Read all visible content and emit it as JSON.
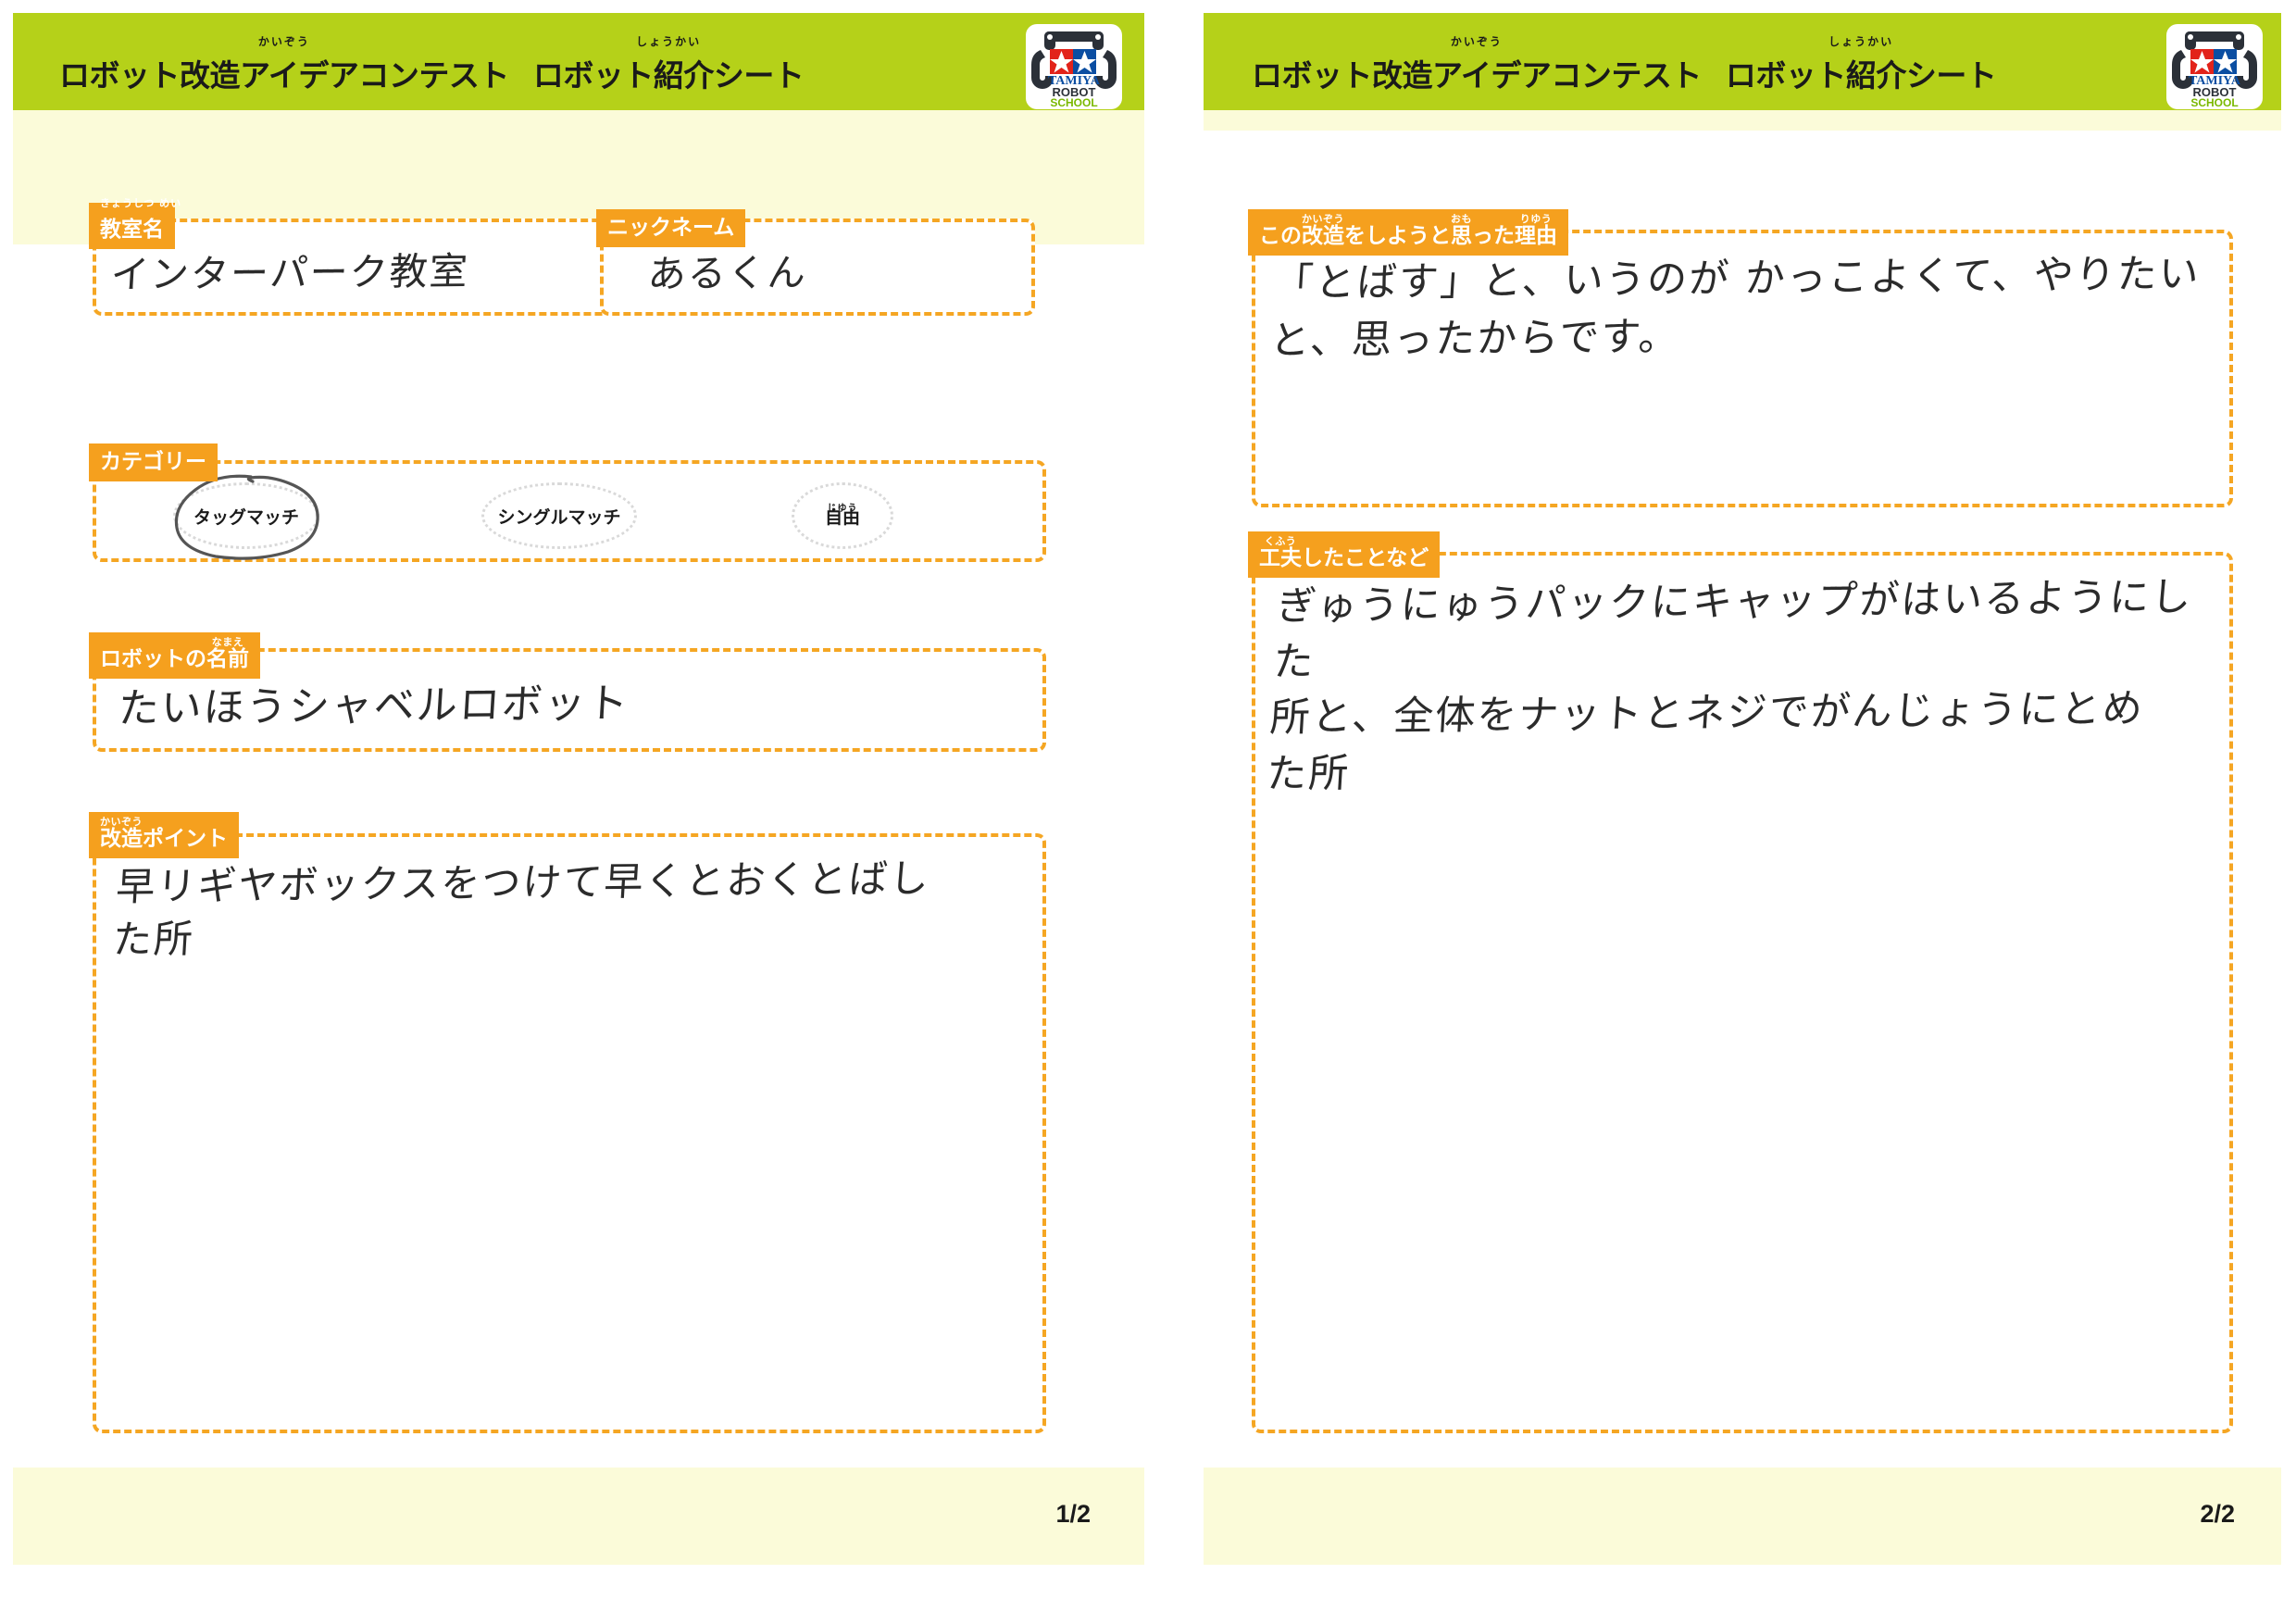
{
  "document": {
    "title": "ロボット改造アイデアコンテスト　ロボット紹介シート",
    "title_part1": "ロボット改造アイデアコンテスト",
    "title_part2": "ロボット紹介シート",
    "ruby_kaizou": "かいぞう",
    "ruby_shoukai": "しょうかい"
  },
  "logo": {
    "brand": "TAMIYA",
    "line2": "ROBOT",
    "line3": "SCHOOL",
    "alt": "tamiya-robot-school-logo"
  },
  "colors": {
    "header_green": "#b5d119",
    "label_orange": "#f5a01e",
    "dash_orange": "#f5a623",
    "cream": "#fbfbd9",
    "ink": "#2b2b2b",
    "logo_red": "#e2231a",
    "logo_blue": "#0b4ea2"
  },
  "page_left": {
    "page_number": "1/2",
    "classroom": {
      "label": "教室名",
      "ruby": "きょうしつ めい",
      "value": "インターパーク教室"
    },
    "nickname": {
      "label": "ニックネーム",
      "ruby": "",
      "value": "あるくん"
    },
    "category": {
      "label": "カテゴリー",
      "ruby": "",
      "options": [
        {
          "label": "タッグマッチ",
          "ruby": "",
          "selected": true
        },
        {
          "label": "シングルマッチ",
          "ruby": "",
          "selected": false
        },
        {
          "label": "自由",
          "ruby": "じゆう",
          "selected": false
        }
      ],
      "selected_value": "タッグマッチ"
    },
    "robot_name": {
      "label_a": "ロボットの",
      "label_b": "名前",
      "ruby": "なまえ",
      "value": "たいほうシャベルロボット"
    },
    "modification_points": {
      "label": "改造ポイント",
      "ruby": "かいぞう",
      "value": "早リギヤボックスをつけて早くとおくとばし\nた所"
    }
  },
  "page_right": {
    "page_number": "2/2",
    "reason": {
      "label_a": "この",
      "label_b": "改造",
      "label_c": "をしようと",
      "label_d": "思",
      "label_e": "った",
      "label_f": "理由",
      "ruby_kaizou": "かいぞう",
      "ruby_omo": "おも",
      "ruby_riyuu": "りゆう",
      "value": "「とばす」と、いうのが かっこよくて、やりたい\nと、思ったからです。"
    },
    "devised": {
      "label_a": "工夫",
      "label_b": "したことなど",
      "ruby": "くふう",
      "value": "ぎゅうにゅうパックにキャップがはいるようにした\n所と、全体をナットとネジでがんじょうにとめ\nた所"
    }
  }
}
